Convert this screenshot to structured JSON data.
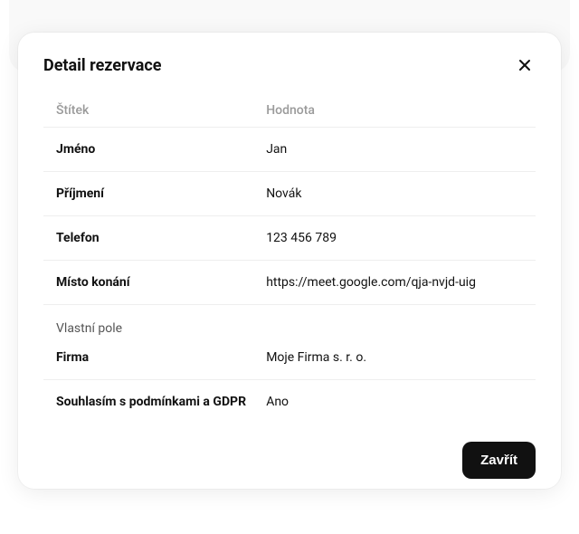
{
  "modal": {
    "title": "Detail rezervace",
    "close_button_label": "Zavřít",
    "table": {
      "header": {
        "label": "Štítek",
        "value": "Hodnota"
      },
      "rows": [
        {
          "label": "Jméno",
          "value": "Jan"
        },
        {
          "label": "Příjmení",
          "value": "Novák"
        },
        {
          "label": "Telefon",
          "value": "123 456 789"
        },
        {
          "label": "Místo konání",
          "value": "https://meet.google.com/qja-nvjd-uig"
        }
      ],
      "custom_section_label": "Vlastní pole",
      "custom_rows": [
        {
          "label": "Firma",
          "value": "Moje Firma s. r. o."
        },
        {
          "label": "Souhlasím s podmínkami a GDPR",
          "value": "Ano"
        }
      ]
    }
  }
}
